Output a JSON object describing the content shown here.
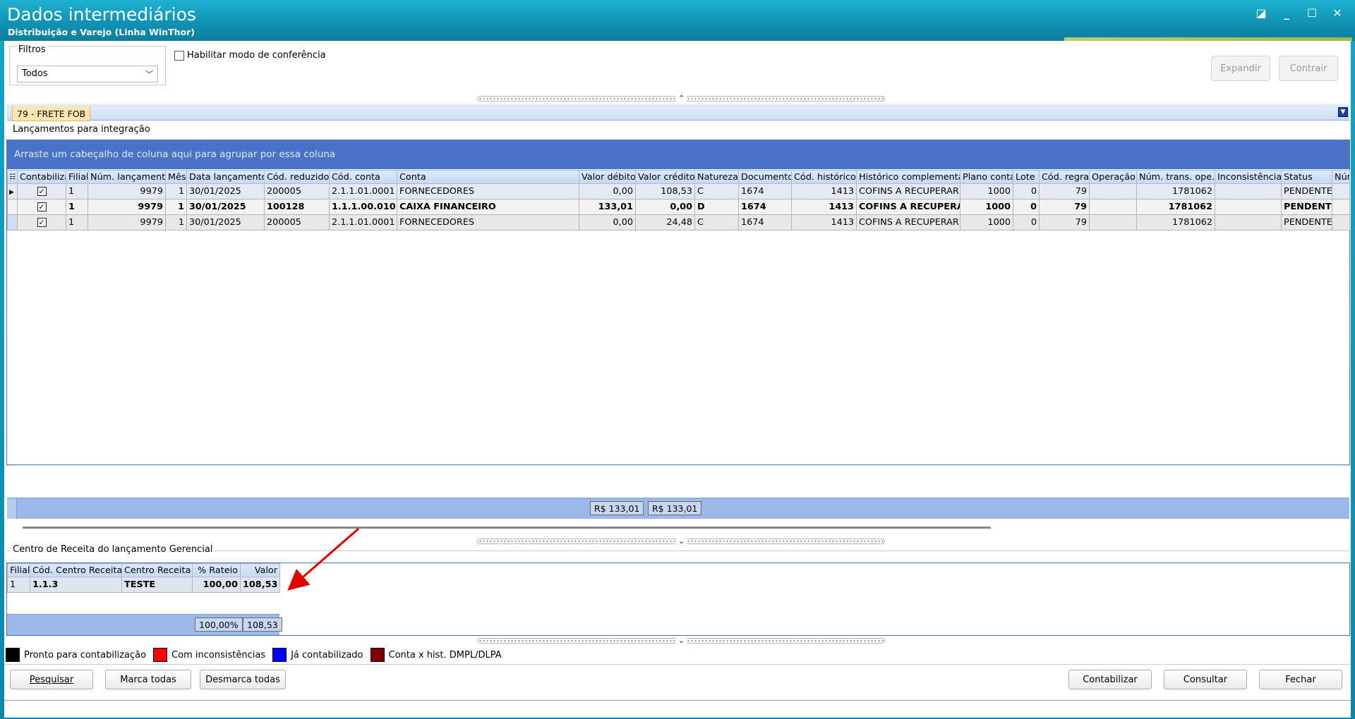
{
  "window": {
    "title": "Dados intermediários",
    "subtitle": "Distribuição e Varejo (Linha WinThor)"
  },
  "filters": {
    "legend": "Filtros",
    "selected": "Todos",
    "conference_mode_label": "Habilitar modo de conferência",
    "conference_mode_checked": false
  },
  "toolbar": {
    "expand_label": "Expandir",
    "collapse_label": "Contrair"
  },
  "tab": {
    "label": "79 - FRETE FOB"
  },
  "entries": {
    "group_title": "Lançamentos para integração",
    "group_hint": "Arraste um cabeçalho de coluna aqui para agrupar por essa coluna",
    "columns": [
      "Contabilizar",
      "Filial",
      "Núm. lançamento",
      "Mês",
      "Data lançamento",
      "Cód. reduzido",
      "Cód. conta",
      "Conta",
      "Valor débito",
      "Valor crédito",
      "Natureza",
      "Documento",
      "Cód. histórico",
      "Histórico complementar",
      "Plano conta",
      "Lote",
      "Cód. regra",
      "Operação",
      "Núm. trans. ope.",
      "Inconsistência",
      "Status",
      "Núm"
    ],
    "rows": [
      {
        "contabilizar": true,
        "filial": "1",
        "num_lancamento": "9979",
        "mes": "1",
        "data": "30/01/2025",
        "cod_reduzido": "200005",
        "cod_conta": "2.1.1.01.0001",
        "conta": "FORNECEDORES",
        "valor_debito": "0,00",
        "valor_credito": "108,53",
        "natureza": "C",
        "documento": "1674",
        "cod_historico": "1413",
        "historico": "COFINS A RECUPERAR",
        "plano_conta": "1000",
        "lote": "0",
        "cod_regra": "79",
        "operacao": "",
        "num_trans": "1781062",
        "inconsistencia": "",
        "status": "PENDENTE",
        "style": "sel"
      },
      {
        "contabilizar": true,
        "filial": "1",
        "num_lancamento": "9979",
        "mes": "1",
        "data": "30/01/2025",
        "cod_reduzido": "100128",
        "cod_conta": "1.1.1.00.010:",
        "conta": "CAIXA FINANCEIRO",
        "valor_debito": "133,01",
        "valor_credito": "0,00",
        "natureza": "D",
        "documento": "1674",
        "cod_historico": "1413",
        "historico": "COFINS A RECUPERA",
        "plano_conta": "1000",
        "lote": "0",
        "cod_regra": "79",
        "operacao": "",
        "num_trans": "1781062",
        "inconsistencia": "",
        "status": "PENDENTE",
        "style": "bold"
      },
      {
        "contabilizar": true,
        "filial": "1",
        "num_lancamento": "9979",
        "mes": "1",
        "data": "30/01/2025",
        "cod_reduzido": "200005",
        "cod_conta": "2.1.1.01.0001",
        "conta": "FORNECEDORES",
        "valor_debito": "0,00",
        "valor_credito": "24,48",
        "natureza": "C",
        "documento": "1674",
        "cod_historico": "1413",
        "historico": "COFINS A RECUPERAR",
        "plano_conta": "1000",
        "lote": "0",
        "cod_regra": "79",
        "operacao": "",
        "num_trans": "1781062",
        "inconsistencia": "",
        "status": "PENDENTE",
        "style": ""
      }
    ],
    "total_debito": "R$ 133,01",
    "total_credito": "R$ 133,01"
  },
  "revenue_center": {
    "group_title": "Centro de Receita do lançamento Gerencial",
    "columns": [
      "Filial",
      "Cód. Centro Receita",
      "Centro Receita",
      "% Rateio",
      "Valor"
    ],
    "rows": [
      {
        "filial": "1",
        "cod": "1.1.3",
        "centro": "TESTE",
        "rateio": "100,00",
        "valor": "108,53"
      }
    ],
    "total_rateio": "100,00%",
    "total_valor": "108,53"
  },
  "legend": [
    {
      "label": "Pronto para contabilização",
      "color": "#000000"
    },
    {
      "label": "Com inconsistências",
      "color": "#ff0000"
    },
    {
      "label": "Já contabilizado",
      "color": "#0000ff"
    },
    {
      "label": "Conta x hist. DMPL/DLPA",
      "color": "#800000"
    }
  ],
  "buttons": {
    "pesquisar": "Pesquisar",
    "marca_todas": "Marca todas",
    "desmarca_todas": "Desmarca todas",
    "contabilizar": "Contabilizar",
    "consultar": "Consultar",
    "fechar": "Fechar"
  },
  "colors": {
    "accent": "#4a72c6",
    "title_bar": "#1298ba",
    "annotation_arrow": "#e00000"
  }
}
